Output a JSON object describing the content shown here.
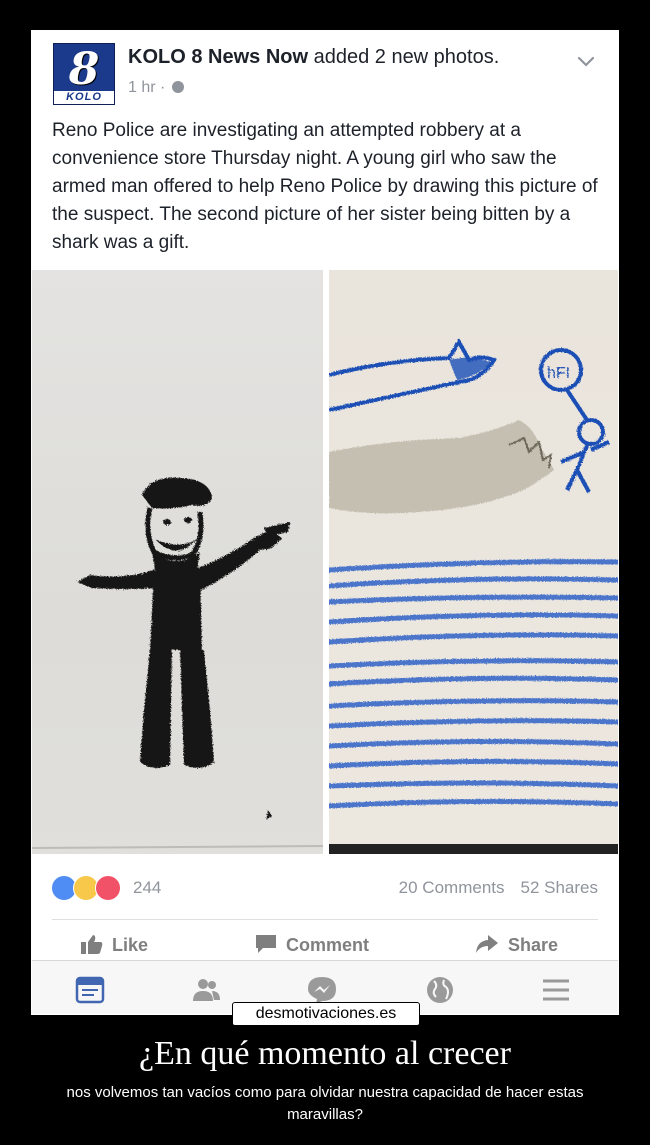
{
  "post": {
    "logo_number": "8",
    "logo_callsign": "KOLO",
    "page_name": "KOLO 8 News Now",
    "action_text": " added 2 new photos.",
    "time": "1 hr",
    "time_sep": " · ",
    "text": "Reno Police are investigating an attempted robbery at a convenience store Thursday night. A young girl who saw the armed man offered to help Reno Police by drawing this picture of the suspect. The second picture of her sister being bitten by a shark was a gift.",
    "drawing_label": "hFI"
  },
  "engagement": {
    "reaction_count": "244",
    "comments": "20 Comments",
    "shares": "52 Shares",
    "reaction_icons": [
      "like-reaction-icon",
      "haha-reaction-icon",
      "love-reaction-icon"
    ]
  },
  "actions": {
    "like": "Like",
    "comment": "Comment",
    "share": "Share"
  },
  "tabbar": {
    "icons": [
      "news-feed-icon",
      "friends-icon",
      "messenger-icon",
      "globe-icon",
      "menu-icon"
    ],
    "active_color": "#4267b2"
  },
  "watermark": "desmotivaciones.es",
  "caption": {
    "title": "¿En qué momento al crecer",
    "subtitle": "nos volvemos tan vacíos como para olvidar nuestra capacidad de hacer estas maravillas?"
  }
}
